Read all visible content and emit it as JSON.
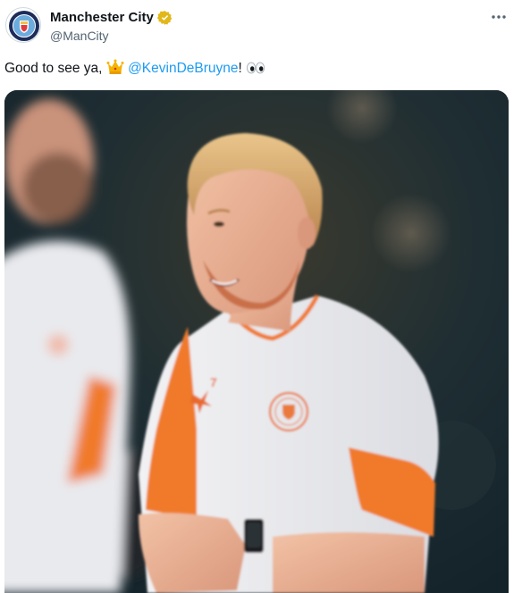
{
  "account": {
    "display_name": "Manchester City",
    "handle": "@ManCity",
    "avatar_icon": "club-crest-icon",
    "verified_icon": "verified-gold-badge-icon"
  },
  "menu": {
    "icon": "more-options-icon"
  },
  "tweet": {
    "text_before": "Good to see ya, ",
    "emoji_crown": "crown-emoji",
    "mention": "@KevinDeBruyne",
    "text_after": "! ",
    "emoji_eyes": "eyes-emoji"
  },
  "media": {
    "kit_number": "7"
  },
  "colors": {
    "link": "#1d9bf0",
    "verified": "#e2b719",
    "sleeve_orange": "#f07a2c"
  }
}
